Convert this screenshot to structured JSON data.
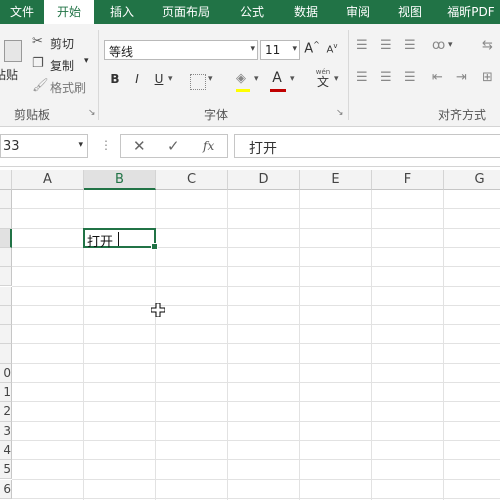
{
  "tabs": [
    "文件",
    "开始",
    "插入",
    "页面布局",
    "公式",
    "数据",
    "审阅",
    "视图",
    "福昕PDF"
  ],
  "active_tab": "开始",
  "clipboard": {
    "paste": "粘贴",
    "cut": "剪切",
    "copy": "复制",
    "format_painter": "格式刷",
    "group_label": "剪贴板"
  },
  "font": {
    "family": "等线",
    "size": "11",
    "bold": "B",
    "italic": "I",
    "underline": "U",
    "font_color_letter": "A",
    "wen_top": "wén",
    "wen": "文",
    "grow": "A",
    "shrink": "A",
    "group_label": "字体"
  },
  "alignment": {
    "group_label": "对齐方式"
  },
  "name_box": "33",
  "fx_label": "fx",
  "formula_value": "打开",
  "columns": [
    "A",
    "B",
    "C",
    "D",
    "E",
    "F",
    "G"
  ],
  "selected_column": "B",
  "row_numbers": [
    "",
    "",
    "",
    "",
    "",
    "",
    "",
    "",
    "",
    "0",
    "1",
    "2",
    "3",
    "4",
    "5",
    "6"
  ],
  "active_cell_text": "打开",
  "colors": {
    "excel_green": "#217346",
    "font_color_bar": "#c00000"
  }
}
